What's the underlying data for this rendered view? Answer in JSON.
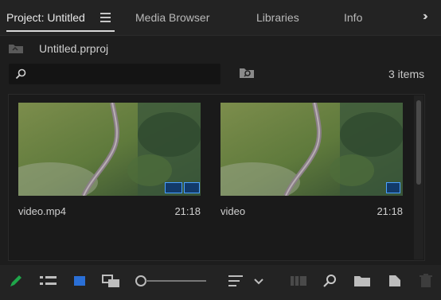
{
  "tabs": [
    {
      "label": "Project: Untitled",
      "active": true
    },
    {
      "label": "Media Browser"
    },
    {
      "label": "Libraries"
    },
    {
      "label": "Info"
    }
  ],
  "project": {
    "name": "Untitled.prproj"
  },
  "search": {
    "placeholder": "",
    "value": ""
  },
  "items_count": "3 items",
  "clips": [
    {
      "name": "video.mp4",
      "duration": "21:18"
    },
    {
      "name": "video",
      "duration": "21:18"
    }
  ],
  "colors": {
    "accent": "#4aa0ff",
    "label_green": "#1fa64a",
    "label_blue": "#2a6fd6"
  }
}
